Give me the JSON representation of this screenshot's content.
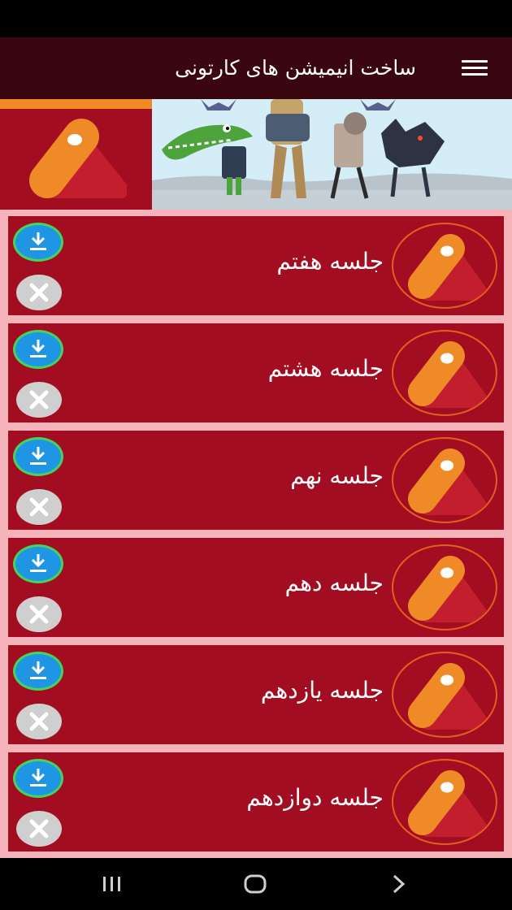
{
  "app_bar": {
    "title": "ساخت انیمیشن های کارتونی",
    "menu_icon": "hamburger-menu-icon"
  },
  "banner": {
    "logo_icon": "app-logo-icon",
    "illustration": "cartoon-characters-illustration"
  },
  "colors": {
    "app_bar": "#3a0610",
    "card": "#a20d22",
    "list_background": "#f6b3b9",
    "logo_orange": "#f08a26",
    "download_blue": "#1e96e3",
    "download_ring": "#47d35a",
    "delete_gray": "#cfcfcf"
  },
  "sessions": [
    {
      "title": "جلسه هفتم"
    },
    {
      "title": "جلسه هشتم"
    },
    {
      "title": "جلسه نهم"
    },
    {
      "title": "جلسه دهم"
    },
    {
      "title": "جلسه یازدهم"
    },
    {
      "title": "جلسه دوازدهم"
    }
  ],
  "session_icons": {
    "logo": "app-logo-icon",
    "download": "download-icon",
    "delete": "close-icon"
  },
  "nav_bar": {
    "recents_icon": "recent-apps-icon",
    "home_icon": "home-icon",
    "back_icon": "back-icon"
  }
}
